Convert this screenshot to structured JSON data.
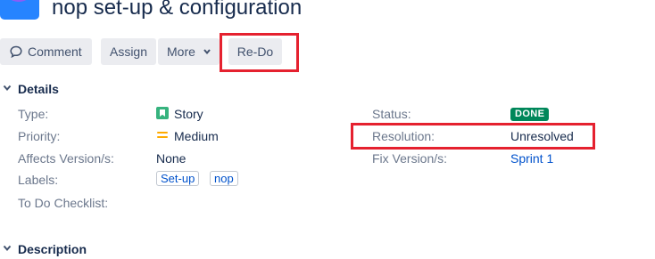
{
  "header": {
    "title": "nop set-up & configuration",
    "avatar_icon": "project-avatar-icon"
  },
  "toolbar": {
    "comment_label": "Comment",
    "assign_label": "Assign",
    "more_label": "More",
    "redo_label": "Re-Do"
  },
  "details": {
    "section_title": "Details",
    "left_fields": {
      "type": {
        "label": "Type:",
        "value": "Story",
        "icon": "story-icon"
      },
      "priority": {
        "label": "Priority:",
        "value": "Medium",
        "icon": "priority-medium-icon"
      },
      "affects_versions": {
        "label": "Affects Version/s:",
        "value": "None"
      },
      "labels": {
        "label": "Labels:",
        "values": [
          "Set-up",
          "nop"
        ]
      },
      "todo_checklist": {
        "label": "To Do Checklist:"
      }
    },
    "right_fields": {
      "status": {
        "label": "Status:",
        "value": "DONE"
      },
      "resolution": {
        "label": "Resolution:",
        "value": "Unresolved"
      },
      "fix_versions": {
        "label": "Fix Version/s:",
        "value": "Sprint 1"
      }
    }
  },
  "description": {
    "section_title": "Description"
  },
  "colors": {
    "highlight_box": "#e5212f",
    "status_done": "#00875a",
    "link": "#0052cc",
    "story": "#36b37e",
    "priority_medium": "#ffab00"
  }
}
